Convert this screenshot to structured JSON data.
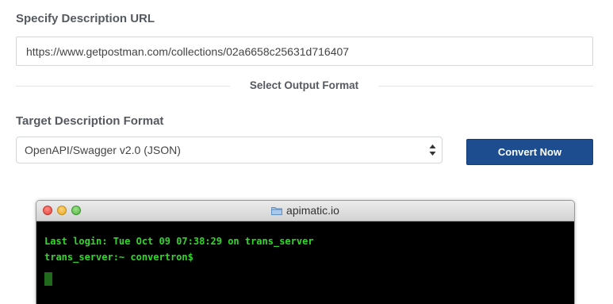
{
  "form": {
    "url_label": "Specify Description URL",
    "url_value": "https://www.getpostman.com/collections/02a6658c25631d716407",
    "divider_text": "Select Output Format",
    "format_label": "Target Description Format",
    "format_selected": "OpenAPI/Swagger v2.0 (JSON)",
    "convert_button": "Convert Now"
  },
  "terminal": {
    "title": "apimatic.io",
    "lines": [
      "Last login: Tue Oct 09 07:38:29 on trans_server",
      "trans_server:~ convertron$"
    ]
  },
  "colors": {
    "accent_button": "#1d4d8f",
    "terminal_text": "#32d62a",
    "terminal_bg": "#000000"
  },
  "icons": {
    "select_arrows": "chevron-up-down-icon",
    "window_folder": "folder-icon"
  }
}
